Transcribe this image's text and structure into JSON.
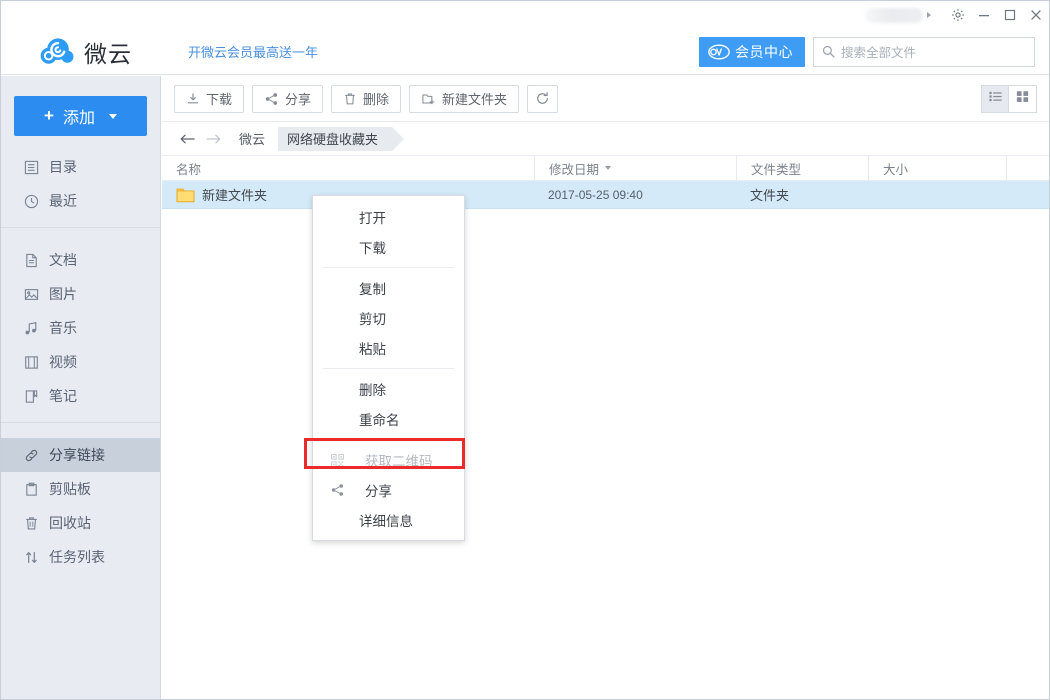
{
  "window": {
    "user_pill": "",
    "controls": [
      {
        "name": "settings",
        "icon": "gear-icon"
      },
      {
        "name": "minimize",
        "icon": "minimize-icon"
      },
      {
        "name": "maximize",
        "icon": "maximize-icon"
      },
      {
        "name": "close",
        "icon": "close-icon"
      }
    ]
  },
  "header": {
    "logo_text": "微云",
    "promo_text": "开微云会员最高送一年",
    "vip_button": "会员中心",
    "search_placeholder": "搜索全部文件",
    "search_value": ""
  },
  "sidebar": {
    "add_button": "添加",
    "groups": [
      {
        "items": [
          {
            "label": "目录",
            "icon": "list-icon",
            "active": false
          },
          {
            "label": "最近",
            "icon": "clock-icon",
            "active": false
          }
        ]
      },
      {
        "items": [
          {
            "label": "文档",
            "icon": "document-icon",
            "active": false
          },
          {
            "label": "图片",
            "icon": "image-icon",
            "active": false
          },
          {
            "label": "音乐",
            "icon": "music-icon",
            "active": false
          },
          {
            "label": "视频",
            "icon": "video-icon",
            "active": false
          },
          {
            "label": "笔记",
            "icon": "note-icon",
            "active": false
          }
        ]
      },
      {
        "items": [
          {
            "label": "分享链接",
            "icon": "link-icon",
            "active": true
          },
          {
            "label": "剪贴板",
            "icon": "clipboard-icon",
            "active": false
          },
          {
            "label": "回收站",
            "icon": "trash-icon",
            "active": false
          },
          {
            "label": "任务列表",
            "icon": "transfer-icon",
            "active": false
          }
        ]
      }
    ]
  },
  "toolbar": {
    "buttons": [
      {
        "label": "下载",
        "icon": "download-icon"
      },
      {
        "label": "分享",
        "icon": "share-icon"
      },
      {
        "label": "删除",
        "icon": "trash-icon"
      },
      {
        "label": "新建文件夹",
        "icon": "new-folder-icon"
      }
    ],
    "refresh_icon": "refresh-icon",
    "view_list": "list-view-icon",
    "view_grid": "grid-view-icon"
  },
  "breadcrumb": {
    "back_icon": "arrow-left-icon",
    "forward_icon": "arrow-right-icon",
    "root": "微云",
    "current": "网络硬盘收藏夹"
  },
  "table": {
    "columns": [
      "名称",
      "修改日期",
      "文件类型",
      "大小"
    ],
    "sorted_column": "修改日期",
    "rows": [
      {
        "name": "新建文件夹",
        "modified": "2017-05-25 09:40",
        "type": "文件夹",
        "size": "",
        "icon": "folder-icon",
        "selected": true
      }
    ]
  },
  "context_menu": {
    "items": [
      {
        "label": "打开",
        "icon": "",
        "disabled": false,
        "separator_after": false
      },
      {
        "label": "下载",
        "icon": "",
        "disabled": false,
        "separator_after": true
      },
      {
        "label": "复制",
        "icon": "",
        "disabled": false,
        "separator_after": false
      },
      {
        "label": "剪切",
        "icon": "",
        "disabled": false,
        "separator_after": false
      },
      {
        "label": "粘贴",
        "icon": "",
        "disabled": false,
        "separator_after": true
      },
      {
        "label": "删除",
        "icon": "",
        "disabled": false,
        "separator_after": false
      },
      {
        "label": "重命名",
        "icon": "",
        "disabled": false,
        "separator_after": true
      },
      {
        "label": "获取二维码",
        "icon": "qrcode-icon",
        "disabled": true,
        "separator_after": false
      },
      {
        "label": "分享",
        "icon": "share-icon",
        "disabled": false,
        "separator_after": false
      },
      {
        "label": "详细信息",
        "icon": "",
        "disabled": false,
        "separator_after": false
      }
    ],
    "highlighted_item": "分享"
  },
  "colors": {
    "brand_blue": "#2d8cf0",
    "vip_blue": "#3e9cf5",
    "link_blue": "#4a90e2",
    "sidebar_bg": "#e8ecf2",
    "sidebar_active": "#c8d0dc",
    "row_selected": "#d5eaf8",
    "folder_yellow": "#ffd24d",
    "highlight_red": "#ed2a2a"
  }
}
